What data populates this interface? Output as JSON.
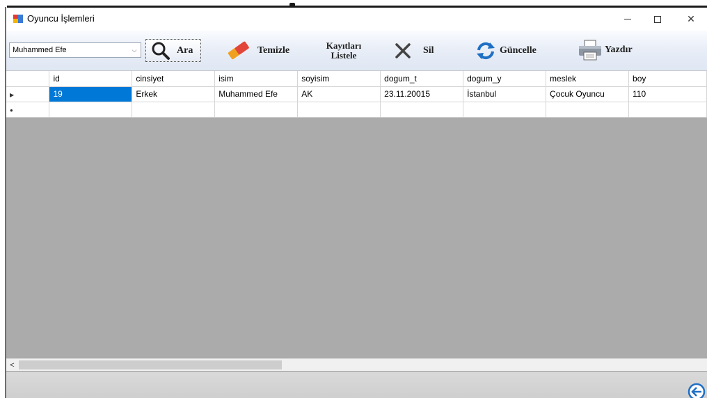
{
  "window": {
    "title": "Oyuncu İşlemleri",
    "min_label": "—",
    "close_label": "✕"
  },
  "toolbar": {
    "combo_value": "Muhammed Efe",
    "combo_arrow": "⌵",
    "ara_label": "Ara",
    "temizle_label": "Temizle",
    "listele_line1": "Kayıtları",
    "listele_line2": "Listele",
    "sil_label": "Sil",
    "guncelle_label": "Güncelle",
    "yazdir_label": "Yazdır"
  },
  "grid": {
    "columns": [
      "id",
      "cinsiyet",
      "isim",
      "soyisim",
      "dogum_t",
      "dogum_y",
      "meslek",
      "boy"
    ],
    "rows": [
      {
        "marker": "▶",
        "cells": [
          "19",
          "Erkek",
          "Muhammed Efe",
          "AK",
          "23.11.20015",
          "İstanbul",
          "Çocuk Oyuncu",
          "110"
        ]
      },
      {
        "marker": "●",
        "cells": [
          "",
          "",
          "",
          "",
          "",
          "",
          "",
          ""
        ]
      }
    ]
  },
  "scrollbar": {
    "left_arrow": "<"
  },
  "colors": {
    "selection": "#0078d7",
    "grid_background": "#ababab",
    "toolbar_top": "#fafcff",
    "toolbar_bottom": "#dfe7f3"
  }
}
